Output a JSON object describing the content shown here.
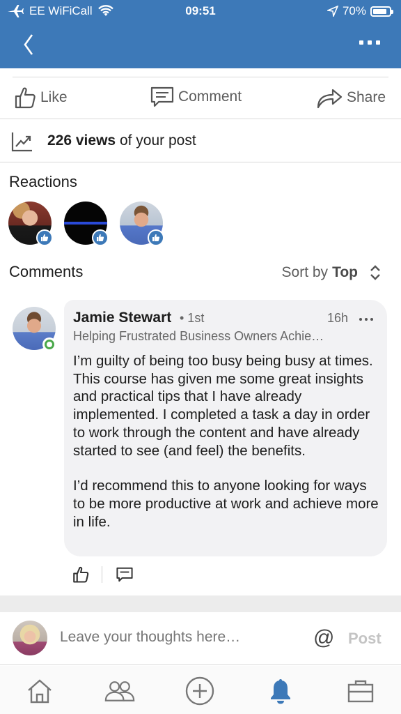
{
  "status_bar": {
    "carrier": "EE WiFiCall",
    "time": "09:51",
    "battery": "70%"
  },
  "header": {
    "back_icon": "chevron-left-icon",
    "more_icon": "more-horizontal-icon"
  },
  "actions": {
    "like_label": "Like",
    "comment_label": "Comment",
    "share_label": "Share"
  },
  "views": {
    "count": "226 views",
    "suffix": "of your post"
  },
  "reactions": {
    "title": "Reactions",
    "count_shown": 3
  },
  "comments": {
    "title": "Comments",
    "sort_prefix": "Sort by",
    "sort_value": "Top",
    "items": [
      {
        "author": "Jamie Stewart",
        "degree": "• 1st",
        "time": "16h",
        "headline": "Helping Frustrated Business Owners Achie…",
        "paragraphs": [
          "I’m guilty of being too busy being busy at times. This course has given me some great insights and practical tips that I have already implemented. I completed a task a day in order to work through the content and have already started to see (and feel) the benefits.",
          "I’d recommend this to anyone looking for ways to be more productive at work and achieve more in life."
        ]
      }
    ]
  },
  "composer": {
    "placeholder": "Leave your thoughts here…",
    "at_symbol": "@",
    "post_label": "Post"
  },
  "nav": {
    "items": [
      "home-icon",
      "my-network-icon",
      "post-icon",
      "notifications-icon",
      "jobs-icon"
    ],
    "active": "notifications-icon"
  },
  "colors": {
    "brand_blue": "#3d79b8",
    "online_green": "#4aa84a",
    "text_primary": "#1d1d1d",
    "text_secondary": "#666666"
  }
}
